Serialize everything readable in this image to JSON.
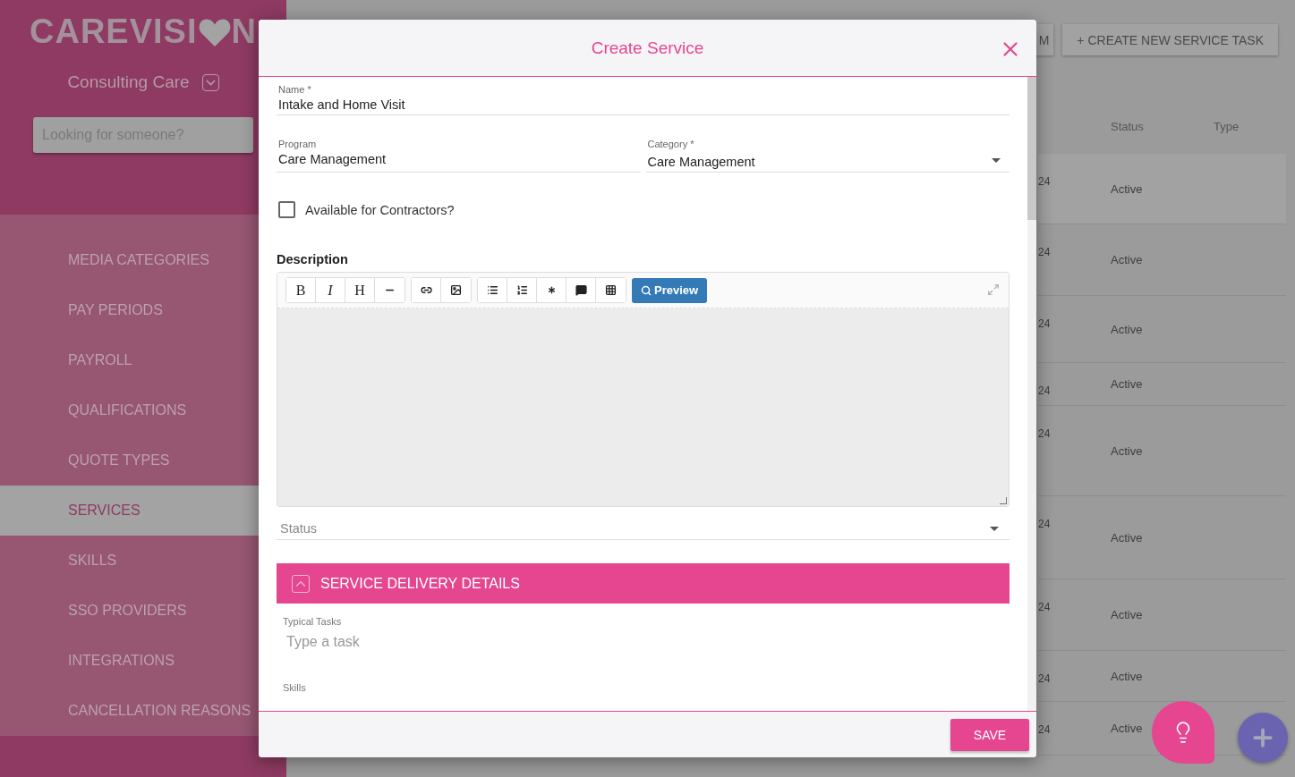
{
  "sidebar": {
    "logo": {
      "before": "CAREVISI",
      "after": "N"
    },
    "company": "Consulting Care",
    "search": {
      "placeholder": "Looking for someone?"
    },
    "items": [
      {
        "label": "MEDIA CATEGORIES",
        "selected": false
      },
      {
        "label": "PAY PERIODS",
        "selected": false
      },
      {
        "label": "PAYROLL",
        "selected": false
      },
      {
        "label": "QUALIFICATIONS",
        "selected": false
      },
      {
        "label": "QUOTE TYPES",
        "selected": false
      },
      {
        "label": "SERVICES",
        "selected": true
      },
      {
        "label": "SKILLS",
        "selected": false
      },
      {
        "label": "SSO PROVIDERS",
        "selected": false
      },
      {
        "label": "INTEGRATIONS",
        "selected": false
      },
      {
        "label": "CANCELLATION REASONS",
        "selected": false
      }
    ]
  },
  "toolbar": {
    "buttons": [
      "M",
      "+ CREATE NEW SERVICE TASK"
    ]
  },
  "table": {
    "columns": [
      "Status",
      "Type"
    ],
    "rows": [
      {
        "column_1": "24",
        "status": "Active"
      },
      {
        "column_1": "24",
        "status": "Active"
      },
      {
        "column_1": "24",
        "status": "Active"
      },
      {
        "column_1": "24",
        "status": "Active"
      },
      {
        "column_1": "24",
        "status": "Active"
      },
      {
        "column_1": "24",
        "status": "Active"
      },
      {
        "column_1": "24",
        "status": "Active"
      },
      {
        "column_1": "24",
        "status": "Active"
      },
      {
        "column_1": "24",
        "status": "Active"
      }
    ]
  },
  "dialog": {
    "title": "Create Service",
    "name": {
      "label": "Name *",
      "value": "Intake and Home Visit"
    },
    "program": {
      "label": "Program",
      "value": "Care Management"
    },
    "category": {
      "label": "Category *",
      "value": "Care Management"
    },
    "contractors": {
      "label": "Available for Contractors?",
      "checked": false
    },
    "description": {
      "label": "Description",
      "toolbar": [
        [
          {
            "kind": "text",
            "label": "B"
          },
          {
            "kind": "italic",
            "label": "I"
          },
          {
            "kind": "text",
            "label": "H"
          },
          {
            "kind": "rule"
          }
        ],
        [
          {
            "kind": "link"
          },
          {
            "kind": "image"
          }
        ],
        [
          {
            "kind": "bullets"
          },
          {
            "kind": "numbers"
          },
          {
            "kind": "asterisk"
          },
          {
            "kind": "comment"
          },
          {
            "kind": "table"
          }
        ]
      ],
      "preview": "Preview"
    },
    "status": {
      "placeholder": "Status"
    },
    "section": {
      "title": "SERVICE DELIVERY DETAILS",
      "expanded": true
    },
    "tasks": {
      "label": "Typical Tasks",
      "placeholder": "Type a task"
    },
    "skills": {
      "label": "Skills"
    },
    "save": "SAVE"
  }
}
